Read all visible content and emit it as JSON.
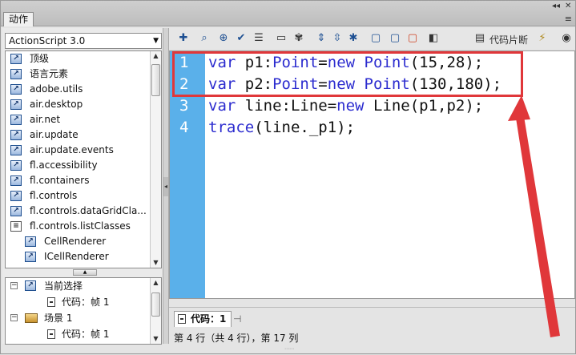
{
  "panel": {
    "tab_title": "动作"
  },
  "left": {
    "language_select": "ActionScript 3.0",
    "tree_items": [
      {
        "label": "顶级"
      },
      {
        "label": "语言元素"
      },
      {
        "label": "adobe.utils"
      },
      {
        "label": "air.desktop"
      },
      {
        "label": "air.net"
      },
      {
        "label": "air.update"
      },
      {
        "label": "air.update.events"
      },
      {
        "label": "fl.accessibility"
      },
      {
        "label": "fl.containers"
      },
      {
        "label": "fl.controls"
      },
      {
        "label": "fl.controls.dataGridCla..."
      },
      {
        "label": "fl.controls.listClasses"
      },
      {
        "label": "CellRenderer"
      },
      {
        "label": "ICellRenderer"
      }
    ],
    "scene_tree": {
      "current_selection": "当前选择",
      "current_code": "代码：帧 1",
      "scene": "场景 1",
      "scene_code": "代码：帧 1"
    }
  },
  "toolbar": {
    "snippets_label": "代码片断",
    "icons": [
      "add-icon",
      "find-icon",
      "target-icon",
      "check-syntax-icon",
      "format-icon",
      "code-hint-icon",
      "debug-icon",
      "collapse-icon",
      "expand-icon",
      "collapse-all-icon",
      "comment-block-icon",
      "comment-line-icon",
      "uncomment-icon",
      "script-assist-icon",
      "snippets-icon",
      "wand-icon"
    ]
  },
  "editor": {
    "line_numbers": [
      "1",
      "2",
      "3",
      "4"
    ],
    "lines": [
      {
        "kw1": "var",
        "rest1": " p1:",
        "kw2": "Point",
        "rest2": "=",
        "kw3": "new",
        "rest3": " ",
        "kw4": "Point",
        "rest4": "(15,28);"
      },
      {
        "kw1": "var",
        "rest1": " p2:",
        "kw2": "Point",
        "rest2": "=",
        "kw3": "new",
        "rest3": " ",
        "kw4": "Point",
        "rest4": "(130,180);"
      },
      {
        "kw1": "var",
        "rest1": " line:Line=",
        "kw2": "new",
        "rest2": " Line(p1,p2);"
      },
      {
        "kw1": "trace",
        "rest1": "(line._p1);"
      }
    ]
  },
  "tabs": {
    "code_tab": "代码：1"
  },
  "status": {
    "text": "第 4 行（共 4 行），第 17 列"
  },
  "colors": {
    "gutter": "#5ab0ea",
    "keyword": "#2c2ccf",
    "annotation": "#e0373a"
  }
}
